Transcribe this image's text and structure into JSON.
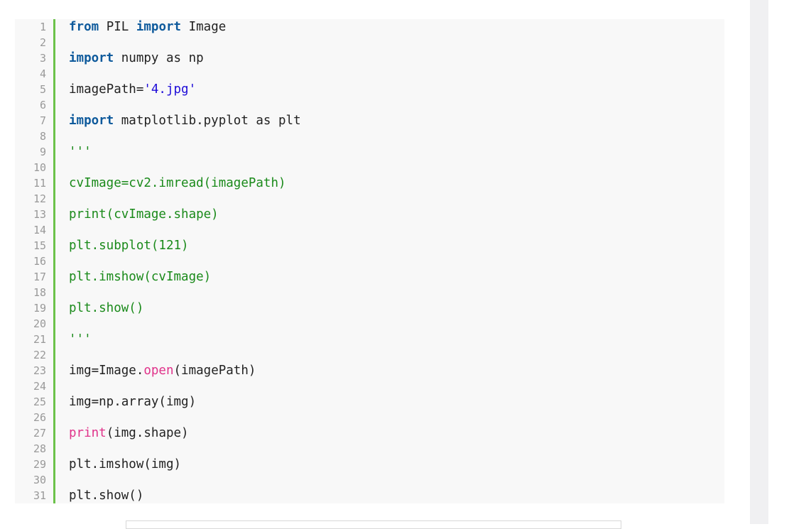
{
  "line_numbers": [
    "1",
    "2",
    "3",
    "4",
    "5",
    "6",
    "7",
    "8",
    "9",
    "10",
    "11",
    "12",
    "13",
    "14",
    "15",
    "16",
    "17",
    "18",
    "19",
    "20",
    "21",
    "22",
    "23",
    "24",
    "25",
    "26",
    "27",
    "28",
    "29",
    "30",
    "31"
  ],
  "code": {
    "l1": {
      "kw1": "from",
      "t1": " PIL ",
      "kw2": "import",
      "t2": " Image"
    },
    "l3": {
      "kw1": "import",
      "t1": " numpy as np"
    },
    "l5": {
      "t1": "imagePath=",
      "s1": "'4.jpg'"
    },
    "l7": {
      "kw1": "import",
      "t1": " matplotlib.pyplot as plt"
    },
    "l9": "'''",
    "l11": "cvImage=cv2.imread(imagePath)",
    "l13": "print(cvImage.shape)",
    "l15": "plt.subplot(121)",
    "l17": "plt.imshow(cvImage)",
    "l19": "plt.show()",
    "l21": "'''",
    "l23": {
      "t1": "img=Image.",
      "p1": "open",
      "t2": "(imagePath)"
    },
    "l25": "img=np.array(img)",
    "l27": {
      "p1": "print",
      "t1": "(img.shape)"
    },
    "l29": "plt.imshow(img)",
    "l31": "plt.show()"
  },
  "colors": {
    "keyword": "#0e5a9c",
    "string": "#1d0bd8",
    "comment": "#1a8a1a",
    "builtin": "#e0328a",
    "gutter_bar": "#6cc24a",
    "line_number": "#999999",
    "code_bg": "#f8f8f8"
  }
}
